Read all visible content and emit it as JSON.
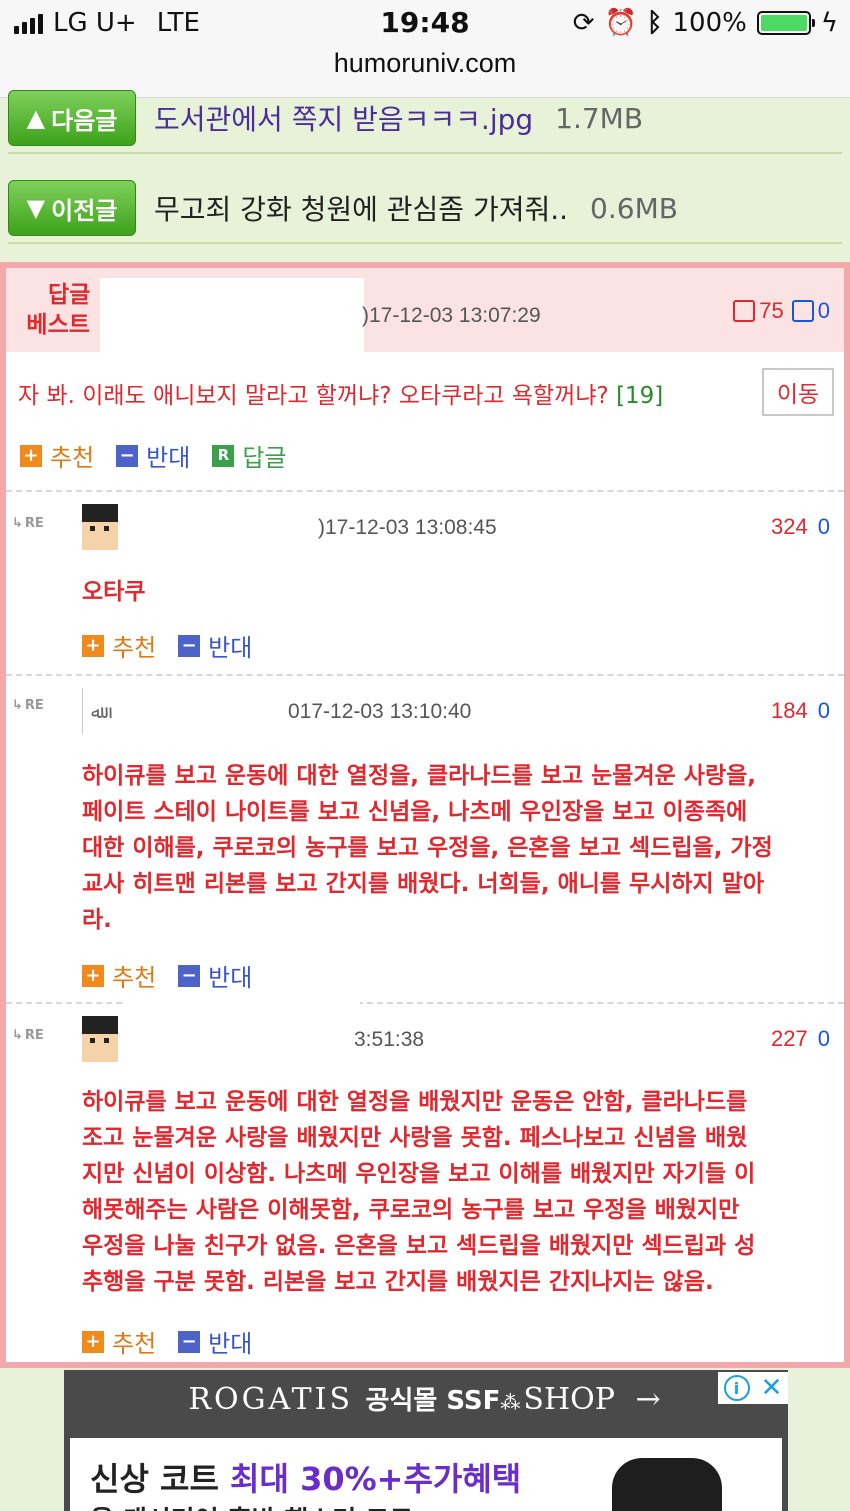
{
  "status_bar": {
    "carrier": "LG U+",
    "network": "LTE",
    "time": "19:48",
    "battery": "100%",
    "icons": [
      "signal-icon",
      "lock-rotation-icon",
      "alarm-icon",
      "bluetooth-icon",
      "battery-icon",
      "charging-icon"
    ],
    "url": "humoruniv.com"
  },
  "nav": {
    "next": {
      "label": "다음글",
      "arrow": "▲",
      "title": "도서관에서 쪽지 받음ㅋㅋㅋ.jpg",
      "size": "1.7MB"
    },
    "prev": {
      "label": "이전글",
      "arrow": "▼",
      "title": "무고죄 강화 청원에 관심좀 가져줘..",
      "size": "0.6MB"
    }
  },
  "best_reply": {
    "label_line1": "답글",
    "label_line2": "베스트",
    "date": ")17-12-03 13:07:29",
    "up": "75",
    "down": "0",
    "text": "자 봐. 이래도 애니보지 말라고 할꺼냐? 오타쿠라고 욕할꺼냐?",
    "reply_count": "[19]",
    "move_label": "이동",
    "actions": {
      "recommend": "추천",
      "oppose": "반대",
      "reply": "답글"
    }
  },
  "comments": [
    {
      "re": "RE",
      "date": ")17-12-03 13:08:45",
      "up": "324",
      "down": "0",
      "text": "오타쿠",
      "recommend": "추천",
      "oppose": "반대"
    },
    {
      "re": "RE",
      "date": "017-12-03 13:10:40",
      "up": "184",
      "down": "0",
      "text": "하이큐를 보고 운동에 대한 열정을, 클라나드를 보고 눈물겨운 사랑을,\n페이트 스테이 나이트를 보고 신념을, 나츠메 우인장을 보고 이종족에\n대한 이해를, 쿠로코의 농구를 보고 우정을, 은혼을 보고 섹드립을, 가정\n교사 히트맨 리본를 보고 간지를 배웠다. 너희들, 애니를 무시하지 말아\n라.",
      "recommend": "추천",
      "oppose": "반대"
    },
    {
      "re": "RE",
      "date": "3:51:38",
      "up": "227",
      "down": "0",
      "text": "하이큐를 보고 운동에 대한 열정을 배웠지만 운동은 안함, 클라나드를\n조고 눈물겨운 사랑을 배웠지만 사랑을 못함. 페스나보고 신념을 배웠\n지만 신념이 이상함. 나츠메 우인장을 보고 이해를 배웠지만 자기들 이\n해못해주는 사람은 이해못함, 쿠로코의 농구를 보고 우정을 배웠지만\n우정을 나눌 친구가 없음. 은혼을 보고 섹드립을 배웠지만 섹드립과 성\n추행을 구분 못함. 리본을 보고 간지를 배웠지믄 간지나지는 않음.",
      "recommend": "추천",
      "oppose": "반대"
    }
  ],
  "ad": {
    "brand": "ROGATIS",
    "brand_kr": "공식몰 SSF",
    "brand_shop": "SHOP",
    "arrow": "→",
    "line1_a": "신상 코트 ",
    "line1_b": "최대 30%+추가혜택",
    "line2": "을 캐시미어 혼방 핸스터 코트",
    "choice_info": "i",
    "choice_close": "✕"
  }
}
